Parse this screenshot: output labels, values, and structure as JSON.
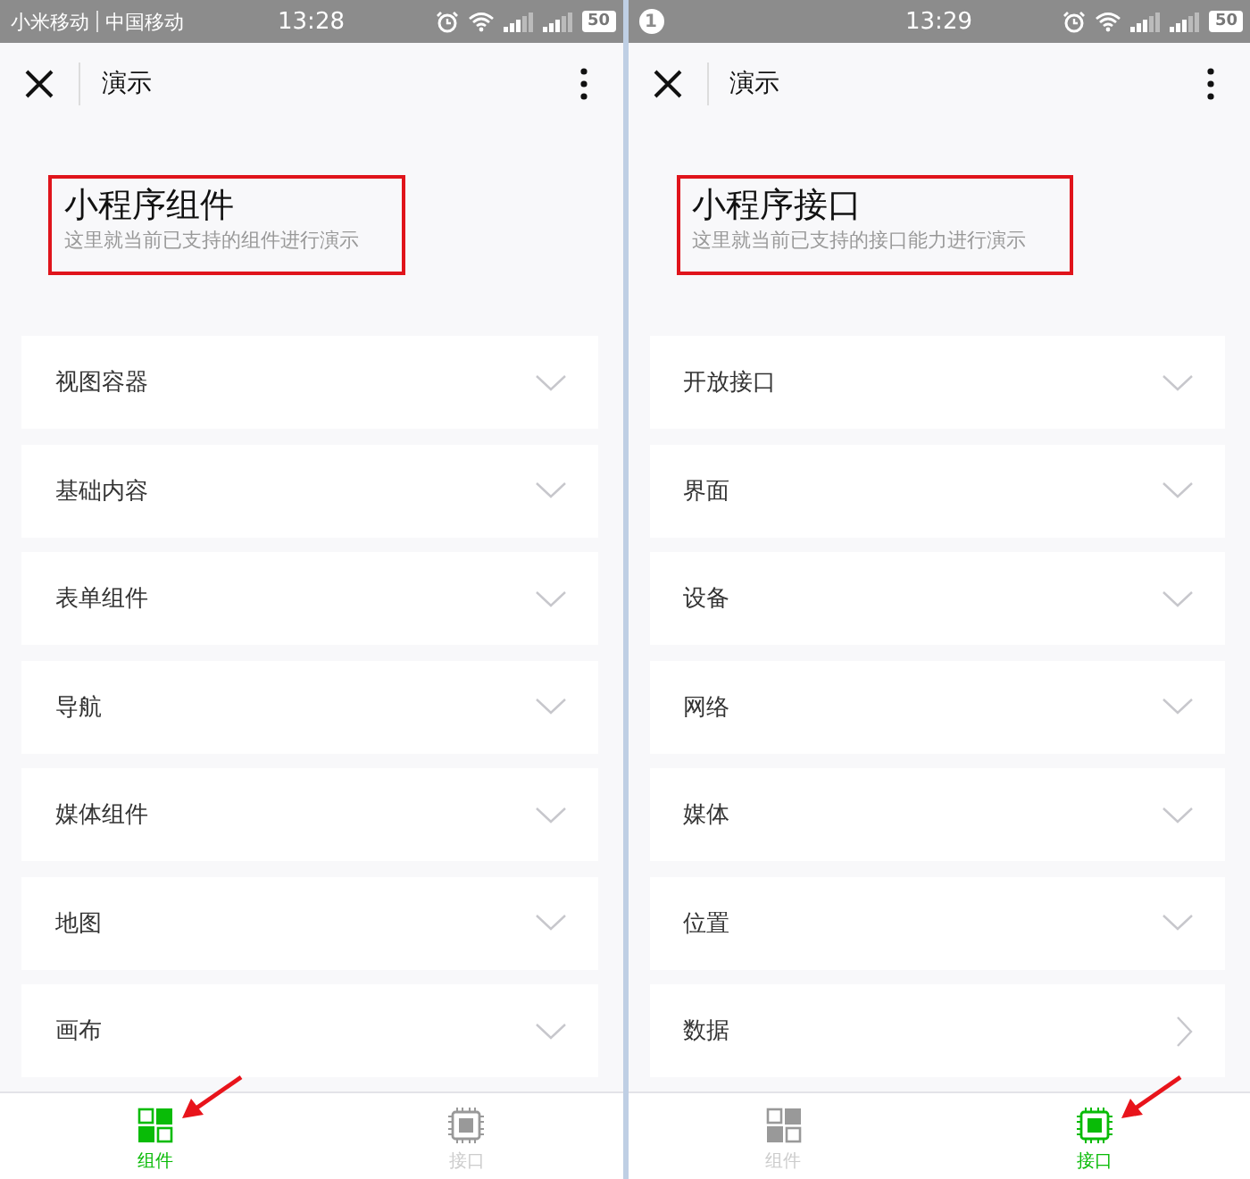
{
  "screens": [
    {
      "status_bar": {
        "carriers": [
          "小米移动",
          "中国移动"
        ],
        "time": "13:28",
        "battery": "50"
      },
      "nav": {
        "title": "演示"
      },
      "header": {
        "title": "小程序组件",
        "subtitle": "这里就当前已支持的组件进行演示"
      },
      "items": [
        {
          "label": "视图容器",
          "kind": "expand"
        },
        {
          "label": "基础内容",
          "kind": "expand"
        },
        {
          "label": "表单组件",
          "kind": "expand"
        },
        {
          "label": "导航",
          "kind": "expand"
        },
        {
          "label": "媒体组件",
          "kind": "expand"
        },
        {
          "label": "地图",
          "kind": "expand"
        },
        {
          "label": "画布",
          "kind": "expand"
        }
      ],
      "tabs": [
        {
          "label": "组件",
          "kind": "grid",
          "selected": true
        },
        {
          "label": "接口",
          "kind": "chip",
          "selected": false
        }
      ]
    },
    {
      "status_bar": {
        "notification": "1",
        "time": "13:29",
        "battery": "50"
      },
      "nav": {
        "title": "演示"
      },
      "header": {
        "title": "小程序接口",
        "subtitle": "这里就当前已支持的接口能力进行演示"
      },
      "items": [
        {
          "label": "开放接口",
          "kind": "expand"
        },
        {
          "label": "界面",
          "kind": "expand"
        },
        {
          "label": "设备",
          "kind": "expand"
        },
        {
          "label": "网络",
          "kind": "expand"
        },
        {
          "label": "媒体",
          "kind": "expand"
        },
        {
          "label": "位置",
          "kind": "expand"
        },
        {
          "label": "数据",
          "kind": "link"
        }
      ],
      "tabs": [
        {
          "label": "组件",
          "kind": "grid",
          "selected": false
        },
        {
          "label": "接口",
          "kind": "chip",
          "selected": true
        }
      ]
    }
  ]
}
